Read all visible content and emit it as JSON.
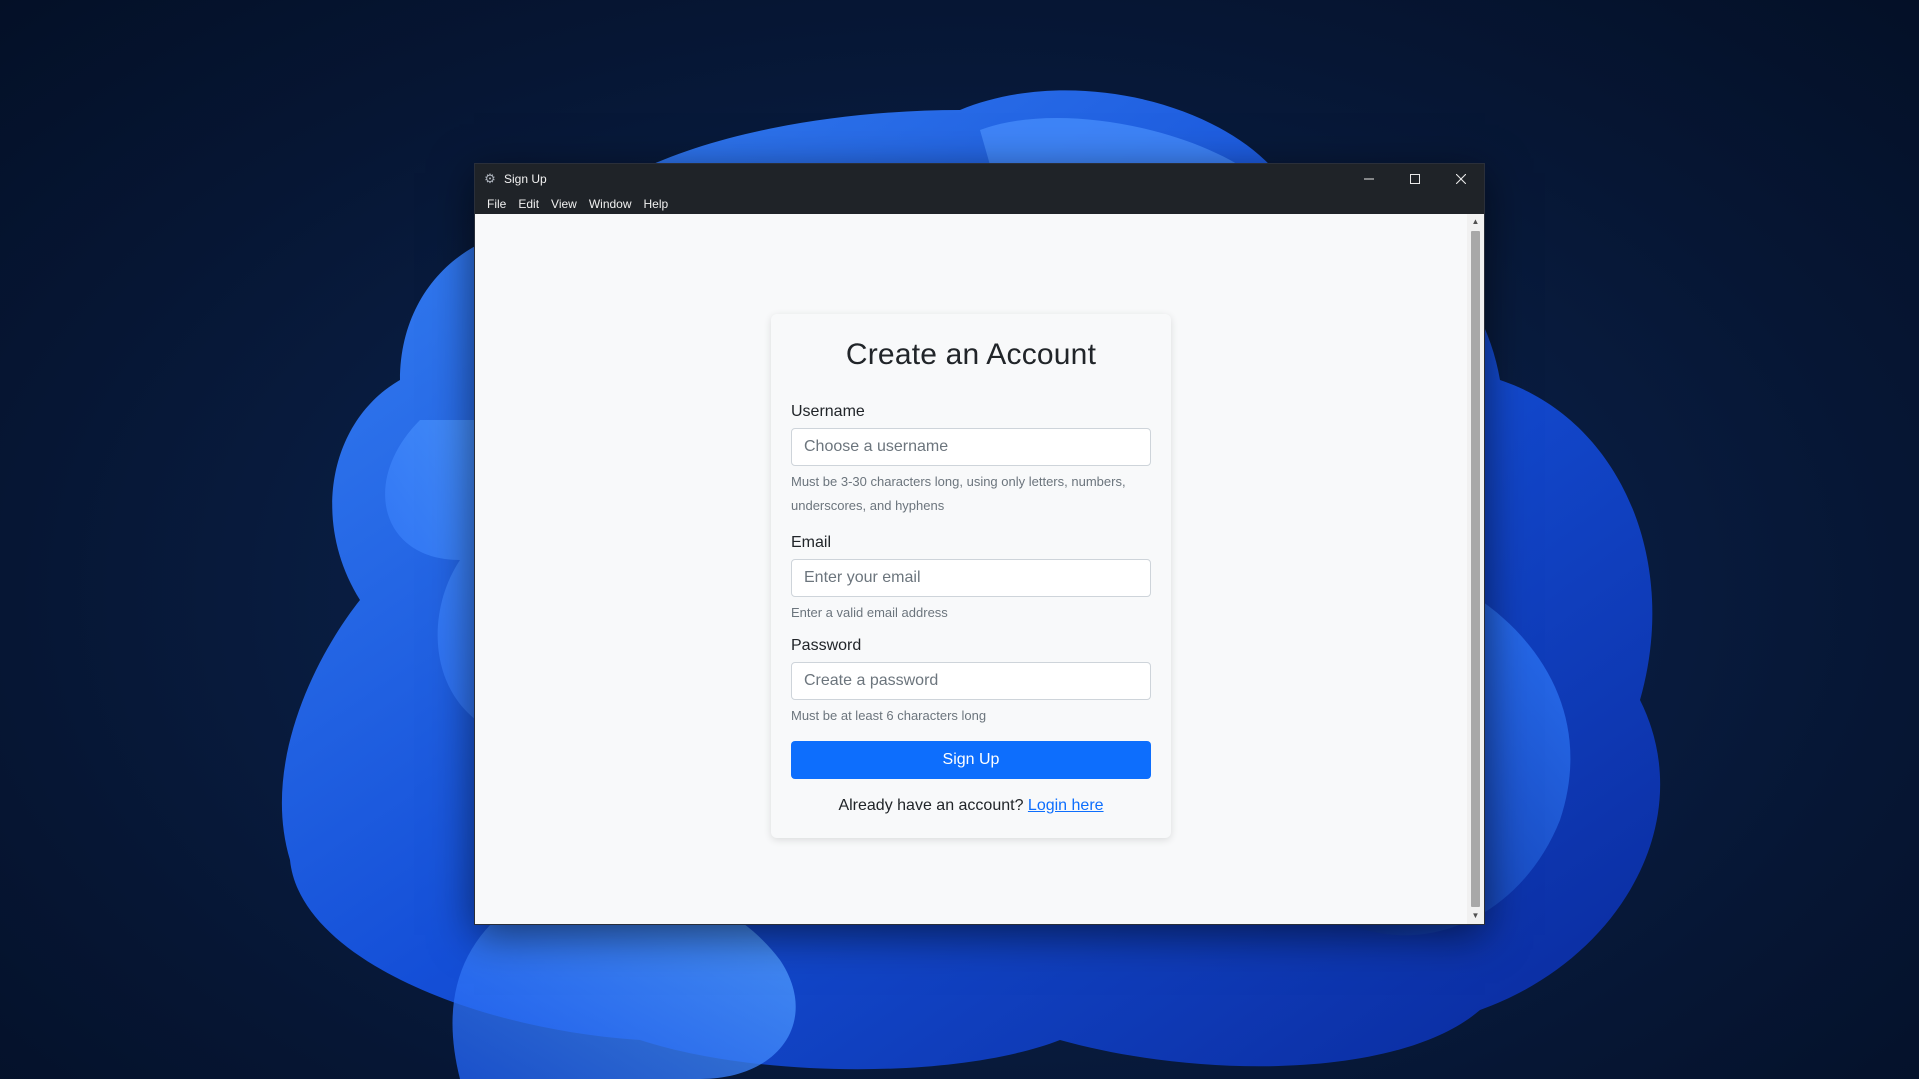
{
  "window": {
    "title": "Sign Up",
    "app_icon": "gear-icon",
    "controls": [
      "minimize-icon",
      "maximize-icon",
      "close-icon"
    ]
  },
  "menubar": {
    "items": [
      "File",
      "Edit",
      "View",
      "Window",
      "Help"
    ]
  },
  "form": {
    "heading": "Create an Account",
    "username": {
      "label": "Username",
      "placeholder": "Choose a username",
      "value": "",
      "help": "Must be 3-30 characters long, using only letters, numbers, underscores, and hyphens"
    },
    "email": {
      "label": "Email",
      "placeholder": "Enter your email",
      "value": "",
      "help": "Enter a valid email address"
    },
    "password": {
      "label": "Password",
      "placeholder": "Create a password",
      "value": "",
      "help": "Must be at least 6 characters long"
    },
    "submit_label": "Sign Up",
    "login_prompt": "Already have an account?",
    "login_link": "Login here"
  },
  "colors": {
    "primary": "#0d6efd",
    "titlebar": "#1f2328",
    "page_bg": "#f8f9fa"
  }
}
